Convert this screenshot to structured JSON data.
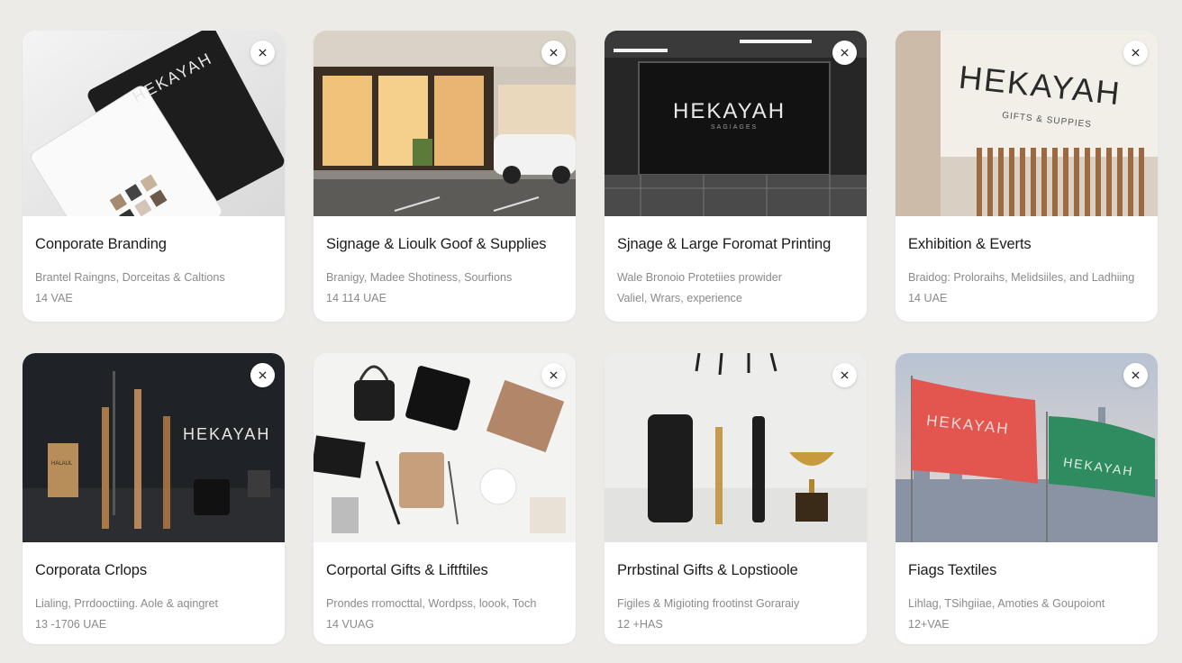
{
  "close_icon_name": "close-icon",
  "cards": [
    {
      "title": "Conporate Branding",
      "line1": "Brantel Raingns, Dorceitas & Caltions",
      "line2": "14 VAE",
      "image": {
        "brand": "HEKAYAH",
        "subtitle": ""
      }
    },
    {
      "title": "Signage & Lioulk Goof & Supplies",
      "line1": "Branigy, Madee Shotiness, Sourfions",
      "line2": "14 114 UAE",
      "image": {
        "brand": "",
        "subtitle": ""
      }
    },
    {
      "title": "Sjnage & Large Foromat Printing",
      "line1": "Wale Bronoio Protetiies prowider",
      "line2": "Valiel, Wrars, experience",
      "image": {
        "brand": "HEKAYAH",
        "subtitle": "SAGIAGES"
      }
    },
    {
      "title": "Exhibition & Everts",
      "line1": "Braidog: Proloraihs, Melidsiiles, and Ladhiing",
      "line2": "14 UAE",
      "image": {
        "brand": "HEKAYAH",
        "subtitle": "GIFTS & SUPPIES"
      }
    },
    {
      "title": "Corporata Crlops",
      "line1": "Lialing, Prrdooctiing. Aole & aqingret",
      "line2": "13 -1706 UAE",
      "image": {
        "brand": "HEKAYAH",
        "subtitle": "HALAUL"
      }
    },
    {
      "title": "Corportal Gifts & Liftftiles",
      "line1": "Prondes rromocttal, Wordpss, loook, Toch",
      "line2": "14 VUAG",
      "image": {
        "brand": "",
        "subtitle": ""
      }
    },
    {
      "title": "Prrbstinal Gifts & Lopstioole",
      "line1": "Figiles & Migioting frootinst Goraraiy",
      "line2": "12 +HAS",
      "image": {
        "brand": "",
        "subtitle": ""
      }
    },
    {
      "title": "Fiags Textiles",
      "line1": "Lihlag, TSihgiiae, Amoties & Goupoiont",
      "line2": "12+VAE",
      "image": {
        "brand": "HEKAYAH",
        "subtitle": "HEKAYAH"
      }
    }
  ]
}
